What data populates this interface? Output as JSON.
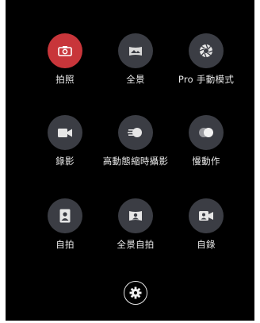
{
  "modes": [
    {
      "label": "拍照",
      "icon": "camera-icon",
      "active": true
    },
    {
      "label": "全景",
      "icon": "panorama-icon",
      "active": false
    },
    {
      "label": "Pro 手動模式",
      "icon": "aperture-icon",
      "active": false
    },
    {
      "label": "錄影",
      "icon": "video-camera-icon",
      "active": false
    },
    {
      "label": "高動態縮時攝影",
      "icon": "timelapse-icon",
      "active": false
    },
    {
      "label": "慢動作",
      "icon": "slow-motion-icon",
      "active": false
    },
    {
      "label": "自拍",
      "icon": "selfie-icon",
      "active": false
    },
    {
      "label": "全景自拍",
      "icon": "panorama-selfie-icon",
      "active": false
    },
    {
      "label": "自錄",
      "icon": "selfie-video-icon",
      "active": false
    }
  ],
  "settings": {
    "icon": "gear-icon"
  },
  "colors": {
    "active": "#c8353a",
    "inactive": "#3b3d44",
    "background": "#000000"
  }
}
